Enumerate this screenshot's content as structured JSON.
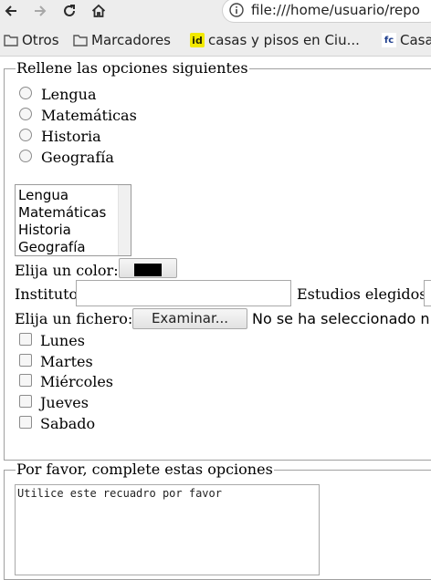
{
  "browser": {
    "url": "file:///home/usuario/repo",
    "bookmarks": [
      {
        "label": "Otros",
        "icon": "folder-icon"
      },
      {
        "label": "Marcadores",
        "icon": "folder-icon"
      },
      {
        "label": "casas y pisos en Ciu...",
        "icon": "idealista-favicon",
        "favicon_text": "id"
      },
      {
        "label": "Casa",
        "icon": "fotocasa-favicon",
        "favicon_text": "fc"
      }
    ]
  },
  "form1": {
    "legend": "Rellene las opciones siguientes",
    "radios": [
      "Lengua",
      "Matemáticas",
      "Historia",
      "Geografía"
    ],
    "list_options": [
      "Lengua",
      "Matemáticas",
      "Historia",
      "Geografía"
    ],
    "color_label": "Elija un color:",
    "color_value": "#000000",
    "instituto_label": "Instituto",
    "estudios_label": "Estudios elegidos",
    "file_label": "Elija un fichero:",
    "file_button": "Examinar...",
    "file_status": "No se ha seleccionado ni",
    "checkboxes": [
      "Lunes",
      "Martes",
      "Miércoles",
      "Jueves",
      "Sabado"
    ]
  },
  "form2": {
    "legend": "Por favor, complete estas opciones",
    "textarea_text": "Utilice este recuadro por favor"
  }
}
